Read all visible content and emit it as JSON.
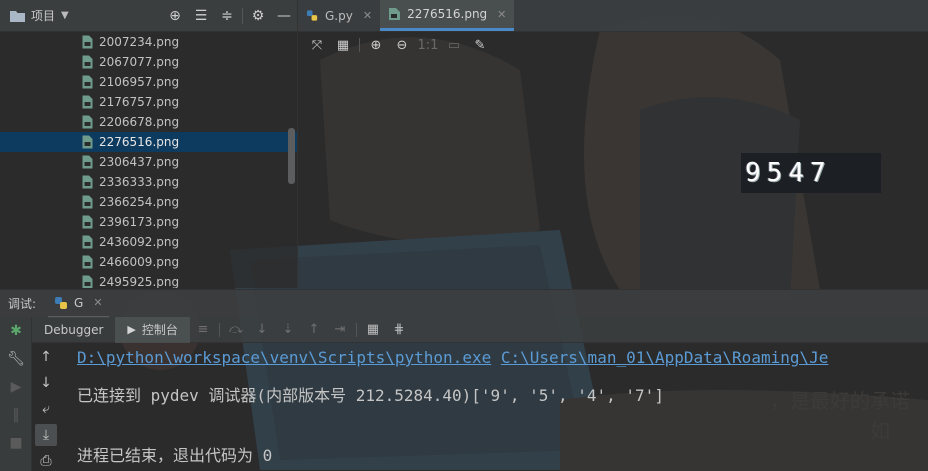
{
  "project_panel": {
    "title": "项目",
    "files": [
      {
        "name": "2007234.png"
      },
      {
        "name": "2067077.png"
      },
      {
        "name": "2106957.png"
      },
      {
        "name": "2176757.png"
      },
      {
        "name": "2206678.png"
      },
      {
        "name": "2276516.png",
        "selected": true
      },
      {
        "name": "2306437.png"
      },
      {
        "name": "2336333.png"
      },
      {
        "name": "2366254.png"
      },
      {
        "name": "2396173.png"
      },
      {
        "name": "2436092.png"
      },
      {
        "name": "2466009.png"
      },
      {
        "name": "2495925.png"
      }
    ]
  },
  "editor": {
    "tabs": [
      {
        "label": "G.py",
        "icon": "python-file-icon"
      },
      {
        "label": "2276516.png",
        "icon": "image-file-icon",
        "active": true
      }
    ],
    "image_text": "9547"
  },
  "debug": {
    "label": "调试:",
    "run_tab": "G",
    "tabs": {
      "debugger": "Debugger",
      "console": "控制台"
    },
    "console_lines": {
      "cmd_python": "D:\\python\\workspace\\venv\\Scripts\\python.exe",
      "cmd_script": "C:\\Users\\man_01\\AppData\\Roaming\\Je",
      "connected": "已连接到 pydev 调试器(内部版本号 212.5284.40)['9', '5', '4', '7']",
      "exit": "进程已结束，退出代码为 0"
    }
  },
  "colors": {
    "selection": "#0d3a5f",
    "accent": "#4a88c7",
    "link": "#5b9bd5",
    "background": "#2b2b2b"
  }
}
